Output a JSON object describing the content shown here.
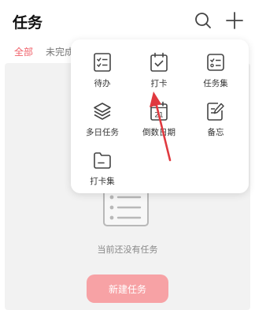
{
  "header": {
    "title": "任务",
    "search_icon": "search-icon",
    "add_icon": "plus-icon"
  },
  "tabs": [
    {
      "label": "全部",
      "active": true
    },
    {
      "label": "未完成",
      "active": false
    }
  ],
  "empty_state": {
    "message": "当前还没有任务",
    "button_label": "新建任务"
  },
  "popup": {
    "items": [
      {
        "label": "待办",
        "icon": "checklist-icon"
      },
      {
        "label": "打卡",
        "icon": "calendar-check-icon"
      },
      {
        "label": "任务集",
        "icon": "task-set-icon"
      },
      {
        "label": "多日任务",
        "icon": "layers-icon"
      },
      {
        "label": "倒数日期",
        "icon": "countdown-calendar-icon"
      },
      {
        "label": "备忘",
        "icon": "memo-edit-icon"
      },
      {
        "label": "打卡集",
        "icon": "folder-icon"
      }
    ],
    "countdown_number": "21"
  },
  "colors": {
    "accent": "#f0616a",
    "button": "#f7a2a5",
    "arrow": "#e0393f"
  }
}
